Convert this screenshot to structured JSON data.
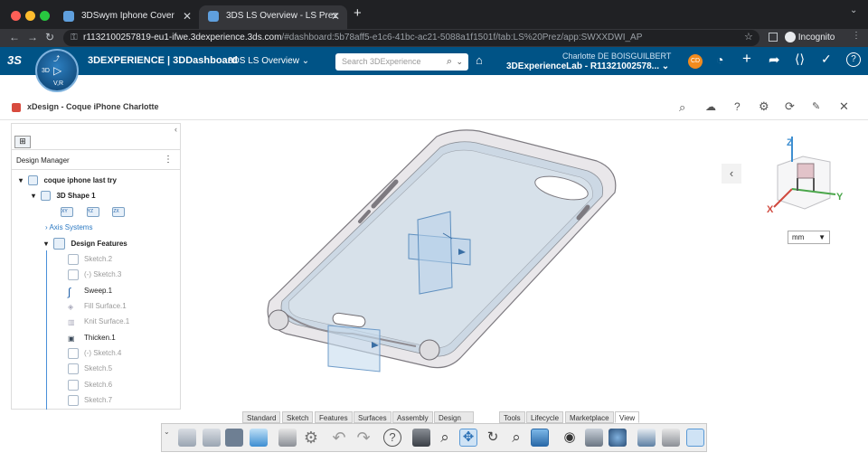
{
  "browser": {
    "tabs": [
      {
        "label": "3DSwym Iphone Cover",
        "close": "✕"
      },
      {
        "label": "3DS LS Overview - LS Prez",
        "close": "✕"
      }
    ],
    "new_tab": "+",
    "url_host": "r1132100257819-eu1-ifwe.3dexperience.3ds.com",
    "url_rest": "/#dashboard:5b78aff5-e1c6-41bc-ac21-5088a1f1501f/tab:LS%20Prez/app:SWXXDWI_AP",
    "incognito_label": "Incognito"
  },
  "appbar": {
    "brand": "3DEXPERIENCE | 3DDashboard",
    "dashboard": "3DS LS Overview",
    "search_placeholder": "Search 3DExperience",
    "user_name": "Charlotte DE BOISGUILBERT",
    "tenant": "3DExperienceLab - R11321002578...",
    "avatar": "CD",
    "compass_top": "3D",
    "compass_bottom": "V,R"
  },
  "app": {
    "title": "xDesign - Coque iPhone Charlotte"
  },
  "design_manager": {
    "title": "Design Manager",
    "root": "coque iphone last try",
    "shape": "3D Shape 1",
    "planes": [
      "XY",
      "YZ",
      "ZX"
    ],
    "axis_systems": "Axis Systems",
    "features_group": "Design Features",
    "features": [
      {
        "label": "Sketch.2",
        "state": "grey"
      },
      {
        "label": "Sketch.3",
        "state": "grey",
        "prefix": "(-)"
      },
      {
        "label": "Sweep.1",
        "state": "active"
      },
      {
        "label": "Fill Surface.1",
        "state": "grey"
      },
      {
        "label": "Knit Surface.1",
        "state": "grey"
      },
      {
        "label": "Thicken.1",
        "state": "active"
      },
      {
        "label": "Sketch.4",
        "state": "grey",
        "prefix": "(-)"
      },
      {
        "label": "Sketch.5",
        "state": "grey"
      },
      {
        "label": "Sketch.6",
        "state": "grey"
      },
      {
        "label": "Sketch.7",
        "state": "grey"
      }
    ]
  },
  "viewport": {
    "unit": "mm",
    "axes": {
      "x": "X",
      "y": "Y",
      "z": "Z"
    }
  },
  "toolbar": {
    "tabs": [
      "Standard",
      "Sketch",
      "Features",
      "Surfaces",
      "Assembly",
      "Design Guidence",
      "Tools",
      "Lifecycle",
      "Marketplace",
      "View"
    ],
    "active_tab": "View"
  },
  "colors": {
    "appbar": "#005386",
    "accent": "#0b77c9"
  }
}
